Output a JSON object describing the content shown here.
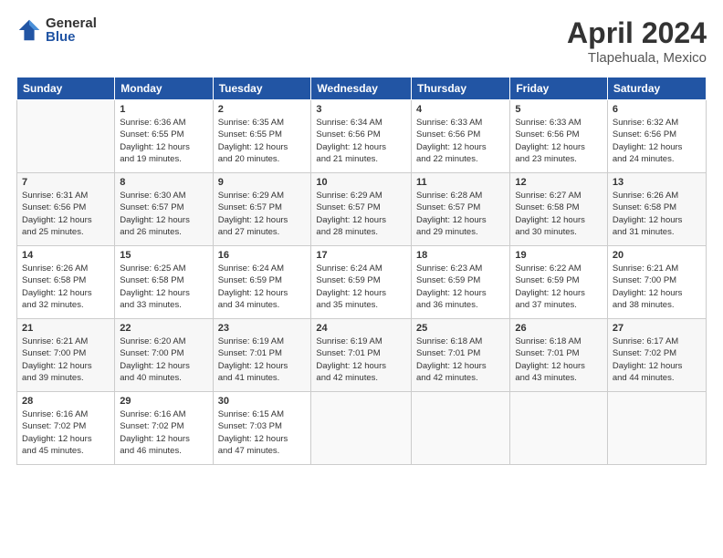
{
  "header": {
    "logo_general": "General",
    "logo_blue": "Blue",
    "title": "April 2024",
    "subtitle": "Tlapehuala, Mexico"
  },
  "weekdays": [
    "Sunday",
    "Monday",
    "Tuesday",
    "Wednesday",
    "Thursday",
    "Friday",
    "Saturday"
  ],
  "weeks": [
    [
      {
        "date": "",
        "info": ""
      },
      {
        "date": "1",
        "info": "Sunrise: 6:36 AM\nSunset: 6:55 PM\nDaylight: 12 hours\nand 19 minutes."
      },
      {
        "date": "2",
        "info": "Sunrise: 6:35 AM\nSunset: 6:55 PM\nDaylight: 12 hours\nand 20 minutes."
      },
      {
        "date": "3",
        "info": "Sunrise: 6:34 AM\nSunset: 6:56 PM\nDaylight: 12 hours\nand 21 minutes."
      },
      {
        "date": "4",
        "info": "Sunrise: 6:33 AM\nSunset: 6:56 PM\nDaylight: 12 hours\nand 22 minutes."
      },
      {
        "date": "5",
        "info": "Sunrise: 6:33 AM\nSunset: 6:56 PM\nDaylight: 12 hours\nand 23 minutes."
      },
      {
        "date": "6",
        "info": "Sunrise: 6:32 AM\nSunset: 6:56 PM\nDaylight: 12 hours\nand 24 minutes."
      }
    ],
    [
      {
        "date": "7",
        "info": "Sunrise: 6:31 AM\nSunset: 6:56 PM\nDaylight: 12 hours\nand 25 minutes."
      },
      {
        "date": "8",
        "info": "Sunrise: 6:30 AM\nSunset: 6:57 PM\nDaylight: 12 hours\nand 26 minutes."
      },
      {
        "date": "9",
        "info": "Sunrise: 6:29 AM\nSunset: 6:57 PM\nDaylight: 12 hours\nand 27 minutes."
      },
      {
        "date": "10",
        "info": "Sunrise: 6:29 AM\nSunset: 6:57 PM\nDaylight: 12 hours\nand 28 minutes."
      },
      {
        "date": "11",
        "info": "Sunrise: 6:28 AM\nSunset: 6:57 PM\nDaylight: 12 hours\nand 29 minutes."
      },
      {
        "date": "12",
        "info": "Sunrise: 6:27 AM\nSunset: 6:58 PM\nDaylight: 12 hours\nand 30 minutes."
      },
      {
        "date": "13",
        "info": "Sunrise: 6:26 AM\nSunset: 6:58 PM\nDaylight: 12 hours\nand 31 minutes."
      }
    ],
    [
      {
        "date": "14",
        "info": "Sunrise: 6:26 AM\nSunset: 6:58 PM\nDaylight: 12 hours\nand 32 minutes."
      },
      {
        "date": "15",
        "info": "Sunrise: 6:25 AM\nSunset: 6:58 PM\nDaylight: 12 hours\nand 33 minutes."
      },
      {
        "date": "16",
        "info": "Sunrise: 6:24 AM\nSunset: 6:59 PM\nDaylight: 12 hours\nand 34 minutes."
      },
      {
        "date": "17",
        "info": "Sunrise: 6:24 AM\nSunset: 6:59 PM\nDaylight: 12 hours\nand 35 minutes."
      },
      {
        "date": "18",
        "info": "Sunrise: 6:23 AM\nSunset: 6:59 PM\nDaylight: 12 hours\nand 36 minutes."
      },
      {
        "date": "19",
        "info": "Sunrise: 6:22 AM\nSunset: 6:59 PM\nDaylight: 12 hours\nand 37 minutes."
      },
      {
        "date": "20",
        "info": "Sunrise: 6:21 AM\nSunset: 7:00 PM\nDaylight: 12 hours\nand 38 minutes."
      }
    ],
    [
      {
        "date": "21",
        "info": "Sunrise: 6:21 AM\nSunset: 7:00 PM\nDaylight: 12 hours\nand 39 minutes."
      },
      {
        "date": "22",
        "info": "Sunrise: 6:20 AM\nSunset: 7:00 PM\nDaylight: 12 hours\nand 40 minutes."
      },
      {
        "date": "23",
        "info": "Sunrise: 6:19 AM\nSunset: 7:01 PM\nDaylight: 12 hours\nand 41 minutes."
      },
      {
        "date": "24",
        "info": "Sunrise: 6:19 AM\nSunset: 7:01 PM\nDaylight: 12 hours\nand 42 minutes."
      },
      {
        "date": "25",
        "info": "Sunrise: 6:18 AM\nSunset: 7:01 PM\nDaylight: 12 hours\nand 42 minutes."
      },
      {
        "date": "26",
        "info": "Sunrise: 6:18 AM\nSunset: 7:01 PM\nDaylight: 12 hours\nand 43 minutes."
      },
      {
        "date": "27",
        "info": "Sunrise: 6:17 AM\nSunset: 7:02 PM\nDaylight: 12 hours\nand 44 minutes."
      }
    ],
    [
      {
        "date": "28",
        "info": "Sunrise: 6:16 AM\nSunset: 7:02 PM\nDaylight: 12 hours\nand 45 minutes."
      },
      {
        "date": "29",
        "info": "Sunrise: 6:16 AM\nSunset: 7:02 PM\nDaylight: 12 hours\nand 46 minutes."
      },
      {
        "date": "30",
        "info": "Sunrise: 6:15 AM\nSunset: 7:03 PM\nDaylight: 12 hours\nand 47 minutes."
      },
      {
        "date": "",
        "info": ""
      },
      {
        "date": "",
        "info": ""
      },
      {
        "date": "",
        "info": ""
      },
      {
        "date": "",
        "info": ""
      }
    ]
  ]
}
